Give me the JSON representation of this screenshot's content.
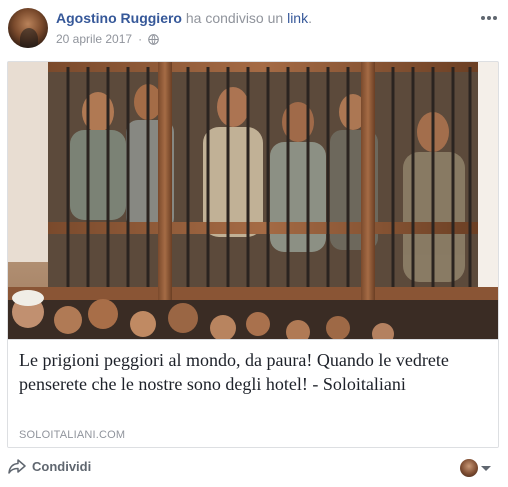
{
  "post": {
    "author": "Agostino Ruggiero",
    "action_text": "ha condiviso un",
    "action_link": "link",
    "action_period": ".",
    "date": "20 aprile 2017",
    "more_icon": "more-horizontal-icon",
    "privacy_icon": "globe-icon"
  },
  "link_card": {
    "title": "Le prigioni peggiori al mondo, da paura! Quando le vedrete penserete che le nostre sono degli hotel! - Soloitaliani",
    "domain": "SOLOITALIANI.COM",
    "image_description_icon": "photo-prisoners-behind-bars"
  },
  "footer": {
    "share_label": "Condividi",
    "share_icon": "share-arrow-icon",
    "caret_icon": "chevron-down-icon"
  },
  "colors": {
    "link_blue": "#365899",
    "meta_gray": "#90949c",
    "text": "#1d2129",
    "border": "#dddfe2"
  }
}
